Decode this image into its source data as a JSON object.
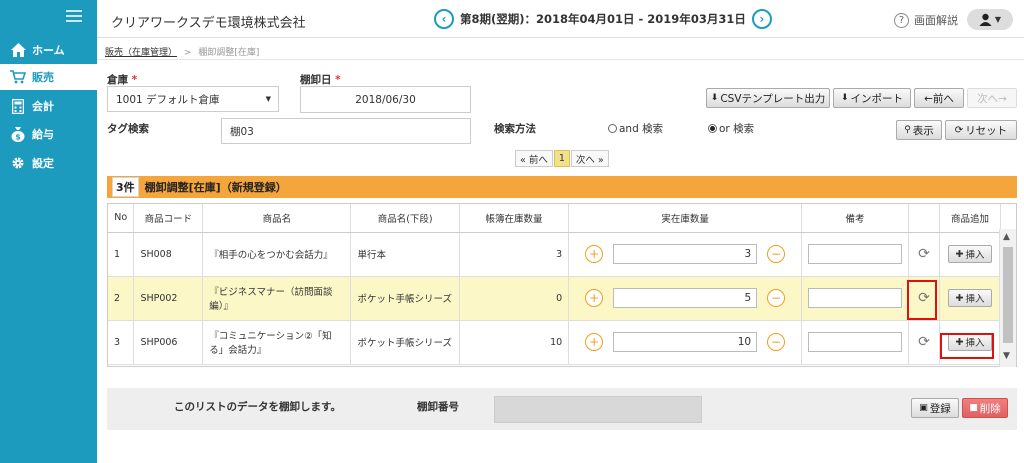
{
  "header": {
    "company": "クリアワークスデモ環境株式会社",
    "period": "第8期(翌期)：2018年04月01日 - 2019年03月31日",
    "help": "画面解説",
    "prev_icon": "chevron-left-icon",
    "next_icon": "chevron-right-icon"
  },
  "sidebar": {
    "items": [
      {
        "label": "ホーム",
        "icon": "home-icon"
      },
      {
        "label": "販売",
        "icon": "cart-icon"
      },
      {
        "label": "会計",
        "icon": "calculator-icon"
      },
      {
        "label": "給与",
        "icon": "money-bag-icon"
      },
      {
        "label": "設定",
        "icon": "gear-icon"
      }
    ]
  },
  "breadcrumb": {
    "link": "販売（在庫管理）",
    "sep": ">",
    "current": "棚卸調整[在庫]"
  },
  "form": {
    "warehouse_label": "倉庫",
    "warehouse_value": "1001 デフォルト倉庫",
    "date_label": "棚卸日",
    "date_value": "2018/06/30",
    "tag_label": "タグ検索",
    "tag_value": "棚03",
    "search_method_label": "検索方法",
    "radio_and": "and 検索",
    "radio_or": "or 検索",
    "required_mark": "*"
  },
  "toolbar": {
    "csv": "CSVテンプレート出力",
    "import": "インポート",
    "prev": "←前へ",
    "next": "次へ→",
    "show": "表示",
    "reset": "リセット"
  },
  "pager": {
    "prev": "« 前へ",
    "current": "1",
    "next": "次へ »"
  },
  "list": {
    "count": "3件",
    "title": "棚卸調整[在庫]（新規登録）",
    "columns": [
      "No",
      "商品コード",
      "商品名",
      "商品名(下段)",
      "帳簿在庫数量",
      "実在庫数量",
      "備考",
      "",
      "商品追加"
    ],
    "insert_label": "挿入",
    "rows": [
      {
        "no": "1",
        "code": "SH008",
        "name": "『相手の心をつかむ会話力』",
        "name2": "単行本",
        "book": "3",
        "actual": "3"
      },
      {
        "no": "2",
        "code": "SHP002",
        "name": "『ビジネスマナー（訪問面談編）』",
        "name2": "ポケット手帳シリーズ",
        "book": "0",
        "actual": "5"
      },
      {
        "no": "3",
        "code": "SHP006",
        "name": "『コミュニケーション②「知る」会話力』",
        "name2": "ポケット手帳シリーズ",
        "book": "10",
        "actual": "10"
      }
    ]
  },
  "footer": {
    "message": "このリストのデータを棚卸します。",
    "number_label": "棚卸番号",
    "register": "登録",
    "delete": "削除"
  },
  "colors": {
    "sidebar": "#1c9bbf",
    "panel_header": "#f4a53b",
    "selected_row": "#fbf7c7",
    "highlight": "#e01010"
  }
}
